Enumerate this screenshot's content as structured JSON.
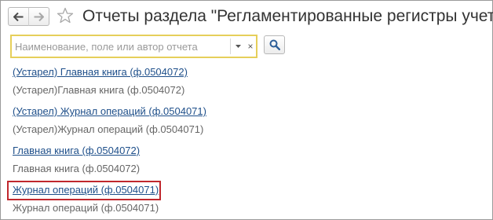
{
  "header": {
    "back_icon": "arrow-left-icon",
    "forward_icon": "arrow-right-icon",
    "favorite_icon": "star-icon",
    "title": "Отчеты раздела \"Регламентированные регистры учета\""
  },
  "search": {
    "placeholder": "Наименование, поле или автор отчета",
    "value": "",
    "dropdown_icon": "chevron-down-icon",
    "clear_label": "×",
    "search_icon": "magnifier-icon"
  },
  "reports": [
    {
      "link": "(Устарел) Главная книга (ф.0504072)",
      "description": "(Устарел)Главная книга (ф.0504072)"
    },
    {
      "link": "(Устарел) Журнал операций (ф.0504071)",
      "description": "(Устарел)Журнал операций (ф.0504071)"
    },
    {
      "link": "Главная книга (ф.0504072)",
      "description": "Главная книга (ф.0504072)"
    },
    {
      "link": "Журнал операций (ф.0504071)",
      "description": "Журнал операций (ф.0504071)",
      "highlighted": true
    }
  ],
  "colors": {
    "link": "#1e4f8a",
    "description": "#666666",
    "search_focus_border": "#e6cf5a",
    "highlight": "#c0272d"
  }
}
